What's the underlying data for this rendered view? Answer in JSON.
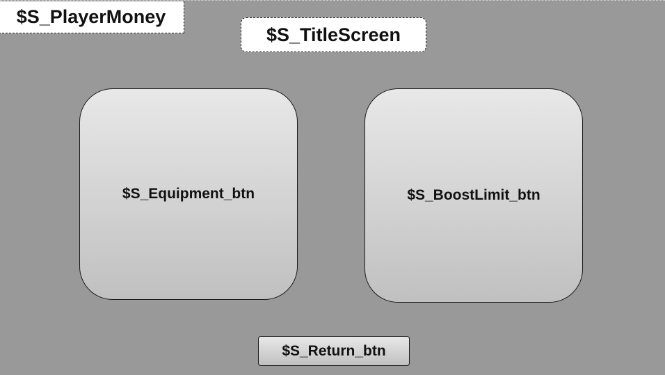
{
  "colors": {
    "background": "#999999",
    "button_gradient_top": "#e8e8e8",
    "button_gradient_bottom": "#c0c0c0",
    "label_background": "#ffffff",
    "text": "#111111"
  },
  "header": {
    "player_money_label": "$S_PlayerMoney",
    "title_label": "$S_TitleScreen"
  },
  "main": {
    "equipment_button_label": "$S_Equipment_btn",
    "boost_limit_button_label": "$S_BoostLimit_btn"
  },
  "footer": {
    "return_button_label": "$S_Return_btn"
  }
}
